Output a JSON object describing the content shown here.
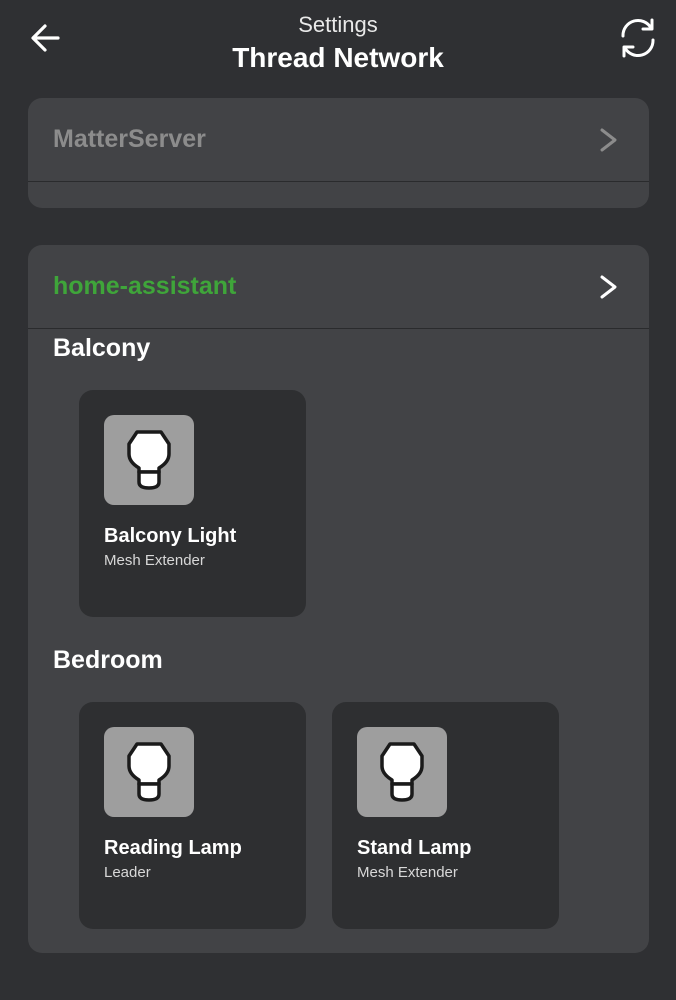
{
  "header": {
    "subtitle": "Settings",
    "title": "Thread Network"
  },
  "colors": {
    "background": "#2f3033",
    "card": "#424346",
    "device_card": "#2e2f31",
    "icon_box": "#9e9e9e",
    "inactive_network": "#8c8c8c",
    "active_network": "#3fa53a"
  },
  "networks": [
    {
      "name": "MatterServer",
      "status": "inactive"
    },
    {
      "name": "home-assistant",
      "status": "active",
      "areas": [
        {
          "name": "Balcony",
          "devices": [
            {
              "name": "Balcony Light",
              "role": "Mesh Extender",
              "icon": "light-bulb-icon"
            }
          ]
        },
        {
          "name": "Bedroom",
          "devices": [
            {
              "name": "Reading Lamp",
              "role": "Leader",
              "icon": "light-bulb-icon"
            },
            {
              "name": "Stand Lamp",
              "role": "Mesh Extender",
              "icon": "light-bulb-icon"
            }
          ]
        }
      ]
    }
  ]
}
